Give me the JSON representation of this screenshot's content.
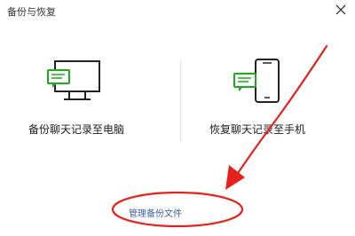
{
  "window": {
    "title": "备份与恢复"
  },
  "options": {
    "backup_to_pc": "备份聊天记录至电脑",
    "restore_to_phone": "恢复聊天记录至手机"
  },
  "manage": {
    "link_label": "管理备份文件"
  },
  "colors": {
    "accent_green": "#1aad19",
    "link_blue": "#3a5fa8",
    "annotation_red": "#e8201c"
  }
}
